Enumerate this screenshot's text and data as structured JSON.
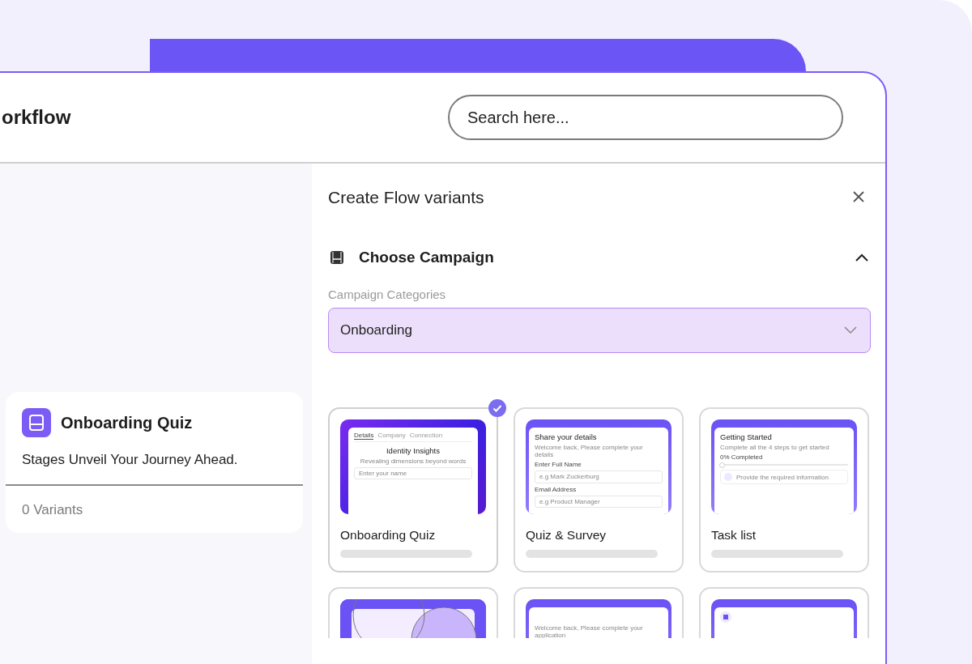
{
  "header": {
    "title": "orkflow",
    "search": {
      "placeholder": "Search here..."
    }
  },
  "flow_card": {
    "title": "Onboarding Quiz",
    "description": "Stages Unveil Your Journey Ahead.",
    "variants": "0 Variants"
  },
  "panel": {
    "title": "Create Flow variants",
    "section": {
      "title": "Choose Campaign",
      "expanded": true
    },
    "category_label": "Campaign Categories",
    "category_value": "Onboarding",
    "templates": [
      {
        "name": "Onboarding Quiz",
        "selected": true,
        "preview": {
          "kind": "steps",
          "tabs": [
            {
              "label": "Details",
              "selected": true
            },
            {
              "label": "Company",
              "selected": false
            },
            {
              "label": "Connection",
              "selected": false
            }
          ],
          "title": "Identity Insights",
          "subtitle": "Revealing dimensions beyond words",
          "placeholder": "Enter your name"
        }
      },
      {
        "name": "Quiz & Survey",
        "selected": false,
        "preview": {
          "kind": "form",
          "title": "Share your details",
          "subtitle": "Welcome back, Please complete your details",
          "fields": [
            {
              "label": "Enter Full Name",
              "placeholder": "e.g Mark Zuckerburg"
            },
            {
              "label": "Email Address",
              "placeholder": "e.g Product Manager"
            }
          ]
        }
      },
      {
        "name": "Task list",
        "selected": false,
        "preview": {
          "kind": "checklist",
          "title": "Getting Started",
          "subtitle": "Complete all the 4 steps to get started",
          "progress_label": "0% Completed",
          "level": 0,
          "step": "Provide the required information"
        }
      },
      {
        "selected": false,
        "preview": {
          "kind": "venn"
        }
      },
      {
        "selected": false,
        "preview": {
          "kind": "form",
          "subtitle": "Welcome back, Please complete your application"
        }
      },
      {
        "selected": false,
        "preview": {
          "kind": "icon"
        }
      }
    ]
  }
}
